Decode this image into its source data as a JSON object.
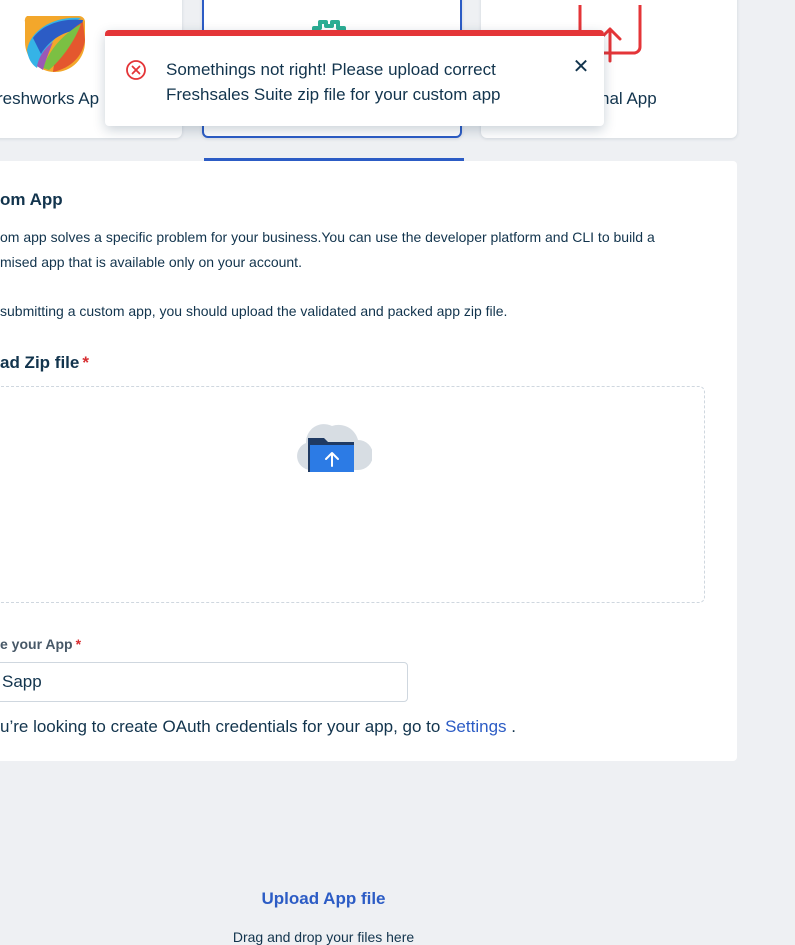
{
  "cards": {
    "freshworks_label": "reshworks Ap",
    "external_label": "nal App"
  },
  "section": {
    "title": "om App",
    "desc_line1": "om app solves a specific problem for your business.You can use the developer platform and CLI to build a",
    "desc_line2": "mised app that is available only on your account.",
    "desc_line3": "submitting a custom app, you should upload the validated and packed app zip file."
  },
  "upload": {
    "label": "ad Zip file",
    "required_mark": "*",
    "title": "Upload App file",
    "hint": "Drag and drop your files here"
  },
  "app_name": {
    "label": "e your App",
    "required_mark": "*",
    "value": "Sapp"
  },
  "oauth": {
    "prefix": "u’re looking to create OAuth credentials for your app, go to ",
    "link": "Settings",
    "suffix": " ."
  },
  "toast": {
    "line1": "Somethings not right! Please upload correct",
    "line2": "Freshsales Suite zip file for your custom app",
    "close": "✕"
  },
  "colors": {
    "primary": "#2c5cc5",
    "error": "#e43538",
    "text": "#12344d",
    "teal": "#2bae94"
  }
}
